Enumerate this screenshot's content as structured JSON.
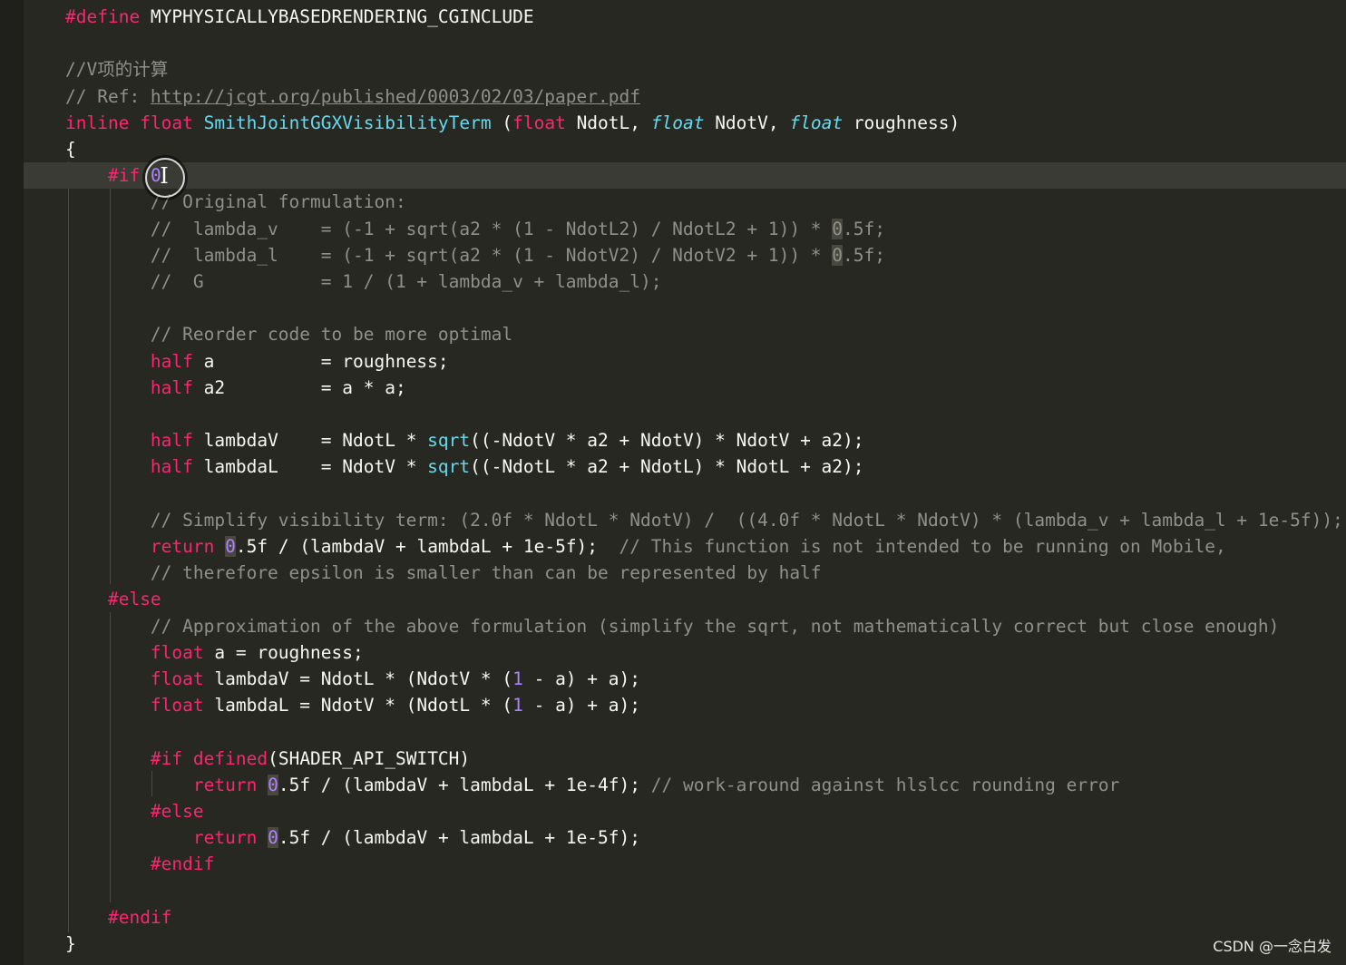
{
  "editor": {
    "lines": [
      {
        "indent": "",
        "tokens": [
          {
            "t": "#define",
            "c": "pp"
          },
          {
            "t": " MYPHYSICALLYBASEDRENDERING_CGINCLUDE",
            "c": ""
          }
        ]
      },
      {
        "indent": "",
        "tokens": []
      },
      {
        "indent": "",
        "tokens": [
          {
            "t": "//V项的计算",
            "c": "cm"
          }
        ]
      },
      {
        "indent": "",
        "tokens": [
          {
            "t": "// Ref: ",
            "c": "cm"
          },
          {
            "t": "http://jcgt.org/published/0003/02/03/paper.pdf",
            "c": "url"
          }
        ]
      },
      {
        "indent": "",
        "tokens": [
          {
            "t": "inline",
            "c": "kw"
          },
          {
            "t": " ",
            "c": ""
          },
          {
            "t": "float",
            "c": "ty"
          },
          {
            "t": " ",
            "c": ""
          },
          {
            "t": "SmithJointGGXVisibilityTerm",
            "c": "fn"
          },
          {
            "t": " (",
            "c": ""
          },
          {
            "t": "float",
            "c": "ty"
          },
          {
            "t": " NdotL, ",
            "c": ""
          },
          {
            "t": "float",
            "c": "it"
          },
          {
            "t": " NdotV, ",
            "c": ""
          },
          {
            "t": "float",
            "c": "it"
          },
          {
            "t": " roughness)",
            "c": ""
          }
        ]
      },
      {
        "indent": "",
        "tokens": [
          {
            "t": "{",
            "c": ""
          }
        ]
      },
      {
        "indent": "    ",
        "current": true,
        "tokens": [
          {
            "t": "#if",
            "c": "pp"
          },
          {
            "t": " ",
            "c": ""
          },
          {
            "t": "0",
            "c": "num"
          }
        ]
      },
      {
        "indent": "        ",
        "tokens": [
          {
            "t": "// Original formulation:",
            "c": "cm"
          }
        ]
      },
      {
        "indent": "        ",
        "tokens": [
          {
            "t": "//  lambda_v    = (-1 + sqrt(a2 * (1 - NdotL2) / NdotL2 + 1)) * ",
            "c": "cm"
          },
          {
            "t": "0",
            "c": "cm hl"
          },
          {
            "t": ".5f;",
            "c": "cm"
          }
        ]
      },
      {
        "indent": "        ",
        "tokens": [
          {
            "t": "//  lambda_l    = (-1 + sqrt(a2 * (1 - NdotV2) / NdotV2 + 1)) * ",
            "c": "cm"
          },
          {
            "t": "0",
            "c": "cm hl"
          },
          {
            "t": ".5f;",
            "c": "cm"
          }
        ]
      },
      {
        "indent": "        ",
        "tokens": [
          {
            "t": "//  G           = 1 / (1 + lambda_v + lambda_l);",
            "c": "cm"
          }
        ]
      },
      {
        "indent": "",
        "tokens": []
      },
      {
        "indent": "        ",
        "tokens": [
          {
            "t": "// Reorder code to be more optimal",
            "c": "cm"
          }
        ]
      },
      {
        "indent": "        ",
        "tokens": [
          {
            "t": "half",
            "c": "ty"
          },
          {
            "t": " a          = roughness;",
            "c": ""
          }
        ]
      },
      {
        "indent": "        ",
        "tokens": [
          {
            "t": "half",
            "c": "ty"
          },
          {
            "t": " a2         = a * a;",
            "c": ""
          }
        ]
      },
      {
        "indent": "",
        "tokens": []
      },
      {
        "indent": "        ",
        "tokens": [
          {
            "t": "half",
            "c": "ty"
          },
          {
            "t": " lambdaV    = NdotL * ",
            "c": ""
          },
          {
            "t": "sqrt",
            "c": "fn"
          },
          {
            "t": "((-NdotV * a2 + NdotV) * NdotV + a2);",
            "c": ""
          }
        ]
      },
      {
        "indent": "        ",
        "tokens": [
          {
            "t": "half",
            "c": "ty"
          },
          {
            "t": " lambdaL    = NdotV * ",
            "c": ""
          },
          {
            "t": "sqrt",
            "c": "fn"
          },
          {
            "t": "((-NdotL * a2 + NdotL) * NdotL + a2);",
            "c": ""
          }
        ]
      },
      {
        "indent": "",
        "tokens": []
      },
      {
        "indent": "        ",
        "tokens": [
          {
            "t": "// Simplify visibility term: (2.0f * NdotL * NdotV) /  ((4.0f * NdotL * NdotV) * (lambda_v + lambda_l + 1e-5f));",
            "c": "cm"
          }
        ]
      },
      {
        "indent": "        ",
        "tokens": [
          {
            "t": "return",
            "c": "kw"
          },
          {
            "t": " ",
            "c": ""
          },
          {
            "t": "0",
            "c": "num hl"
          },
          {
            "t": ".5f / (lambdaV + lambdaL + 1e-5f);  ",
            "c": ""
          },
          {
            "t": "// This function is not intended to be running on Mobile,",
            "c": "cm"
          }
        ]
      },
      {
        "indent": "        ",
        "tokens": [
          {
            "t": "// therefore epsilon is smaller than can be represented by half",
            "c": "cm"
          }
        ]
      },
      {
        "indent": "    ",
        "tokens": [
          {
            "t": "#else",
            "c": "pp"
          }
        ]
      },
      {
        "indent": "        ",
        "tokens": [
          {
            "t": "// Approximation of the above formulation (simplify the sqrt, not mathematically correct but close enough)",
            "c": "cm"
          }
        ]
      },
      {
        "indent": "        ",
        "tokens": [
          {
            "t": "float",
            "c": "ty"
          },
          {
            "t": " a = roughness;",
            "c": ""
          }
        ]
      },
      {
        "indent": "        ",
        "tokens": [
          {
            "t": "float",
            "c": "ty"
          },
          {
            "t": " lambdaV = NdotL * (NdotV * (",
            "c": ""
          },
          {
            "t": "1",
            "c": "num"
          },
          {
            "t": " - a) + a);",
            "c": ""
          }
        ]
      },
      {
        "indent": "        ",
        "tokens": [
          {
            "t": "float",
            "c": "ty"
          },
          {
            "t": " lambdaL = NdotV * (NdotL * (",
            "c": ""
          },
          {
            "t": "1",
            "c": "num"
          },
          {
            "t": " - a) + a);",
            "c": ""
          }
        ]
      },
      {
        "indent": "",
        "tokens": []
      },
      {
        "indent": "        ",
        "tokens": [
          {
            "t": "#if",
            "c": "pp"
          },
          {
            "t": " ",
            "c": ""
          },
          {
            "t": "defined",
            "c": "kw"
          },
          {
            "t": "(SHADER_API_SWITCH)",
            "c": ""
          }
        ]
      },
      {
        "indent": "            ",
        "tokens": [
          {
            "t": "return",
            "c": "kw"
          },
          {
            "t": " ",
            "c": ""
          },
          {
            "t": "0",
            "c": "num hl"
          },
          {
            "t": ".5f / (lambdaV + lambdaL + 1e-4f); ",
            "c": ""
          },
          {
            "t": "// work-around against hlslcc rounding error",
            "c": "cm"
          }
        ]
      },
      {
        "indent": "        ",
        "tokens": [
          {
            "t": "#else",
            "c": "pp"
          }
        ]
      },
      {
        "indent": "            ",
        "tokens": [
          {
            "t": "return",
            "c": "kw"
          },
          {
            "t": " ",
            "c": ""
          },
          {
            "t": "0",
            "c": "num hl"
          },
          {
            "t": ".5f / (lambdaV + lambdaL + 1e-5f);",
            "c": ""
          }
        ]
      },
      {
        "indent": "        ",
        "tokens": [
          {
            "t": "#endif",
            "c": "pp"
          }
        ]
      },
      {
        "indent": "",
        "tokens": []
      },
      {
        "indent": "    ",
        "tokens": [
          {
            "t": "#endif",
            "c": "pp"
          }
        ]
      },
      {
        "indent": "",
        "tokens": [
          {
            "t": "}",
            "c": ""
          }
        ]
      }
    ]
  },
  "watermark": "CSDN @一念白发"
}
